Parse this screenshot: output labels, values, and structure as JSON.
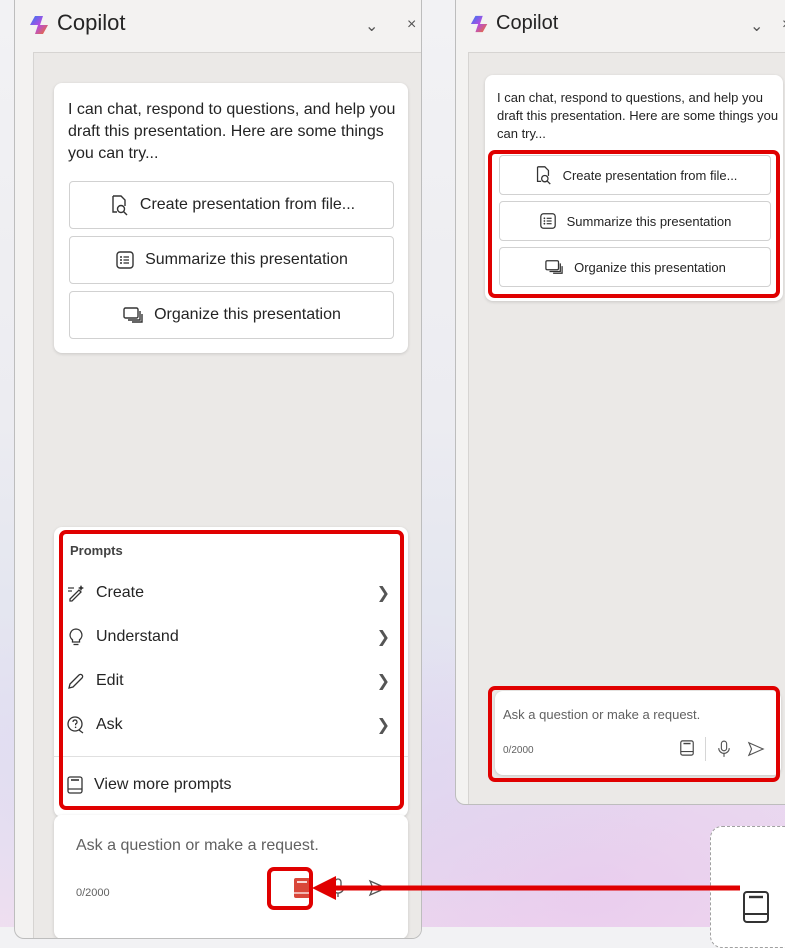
{
  "left_panel": {
    "title": "Copilot",
    "intro": "I can chat, respond to questions, and help you draft this presentation. Here are some things you can try...",
    "suggestions": [
      {
        "label": "Create presentation from file...",
        "icon": "document-search-icon"
      },
      {
        "label": "Summarize this presentation",
        "icon": "list-icon"
      },
      {
        "label": "Organize this presentation",
        "icon": "slides-icon"
      }
    ],
    "prompts": {
      "heading": "Prompts",
      "items": [
        {
          "label": "Create",
          "icon": "pen-sparkle-icon"
        },
        {
          "label": "Understand",
          "icon": "lightbulb-icon"
        },
        {
          "label": "Edit",
          "icon": "pencil-icon"
        },
        {
          "label": "Ask",
          "icon": "question-chat-icon"
        }
      ],
      "view_more": "View more prompts"
    },
    "input": {
      "placeholder": "Ask a question or make a request.",
      "counter": "0/2000"
    }
  },
  "right_panel": {
    "title": "Copilot",
    "intro": "I can chat, respond to questions, and help you draft this presentation. Here are some things you can try...",
    "suggestions": [
      {
        "label": "Create presentation from file...",
        "icon": "document-search-icon"
      },
      {
        "label": "Summarize this presentation",
        "icon": "list-icon"
      },
      {
        "label": "Organize this presentation",
        "icon": "slides-icon"
      }
    ],
    "input": {
      "placeholder": "Ask a question or make a request.",
      "counter": "0/2000"
    }
  },
  "colors": {
    "highlight": "#e00000",
    "prompt_button": "#d9473a"
  }
}
